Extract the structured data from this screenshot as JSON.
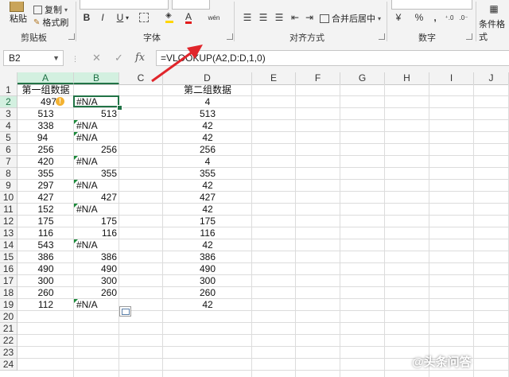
{
  "ribbon": {
    "clipboard": {
      "paste": "粘贴",
      "copy": "复制",
      "format_painter": "格式刷",
      "label": "剪贴板"
    },
    "font": {
      "label": "字体",
      "bold": "B",
      "italic": "I",
      "underline": "U",
      "font_color_glyph": "A",
      "phonetic": "wén"
    },
    "alignment": {
      "label": "对齐方式",
      "merge_center": "合并后居中"
    },
    "number": {
      "label": "数字",
      "percent": "%",
      "comma": ","
    },
    "styles": {
      "conditional": "条件格式"
    }
  },
  "formula_bar": {
    "name_box": "B2",
    "fx": "fx",
    "formula": "=VLOOKUP(A2,D:D,1,0)"
  },
  "columns": [
    "A",
    "B",
    "C",
    "D",
    "E",
    "F",
    "G",
    "H",
    "I",
    "J"
  ],
  "rows": [
    "1",
    "2",
    "3",
    "4",
    "5",
    "6",
    "7",
    "8",
    "9",
    "10",
    "11",
    "12",
    "13",
    "14",
    "15",
    "16",
    "17",
    "18",
    "19",
    "20",
    "21",
    "22",
    "23",
    "24"
  ],
  "headers": {
    "a1": "第一组数据",
    "d1": "第二组数据"
  },
  "col_a": [
    "497",
    "513",
    "338",
    "94",
    "256",
    "420",
    "355",
    "297",
    "427",
    "152",
    "175",
    "116",
    "543",
    "386",
    "490",
    "300",
    "260",
    "112"
  ],
  "col_b": [
    "#N/A",
    "513",
    "#N/A",
    "#N/A",
    "256",
    "#N/A",
    "355",
    "#N/A",
    "427",
    "#N/A",
    "175",
    "116",
    "#N/A",
    "386",
    "490",
    "300",
    "260",
    "#N/A"
  ],
  "col_d": [
    "4",
    "513",
    "42",
    "42",
    "256",
    "4",
    "355",
    "42",
    "427",
    "42",
    "175",
    "116",
    "42",
    "386",
    "490",
    "300",
    "260",
    "42"
  ],
  "watermark": "@头条问答",
  "colors": {
    "accent": "#217346",
    "arrow": "#e0252b",
    "selected_header": "#d3f0e0"
  }
}
